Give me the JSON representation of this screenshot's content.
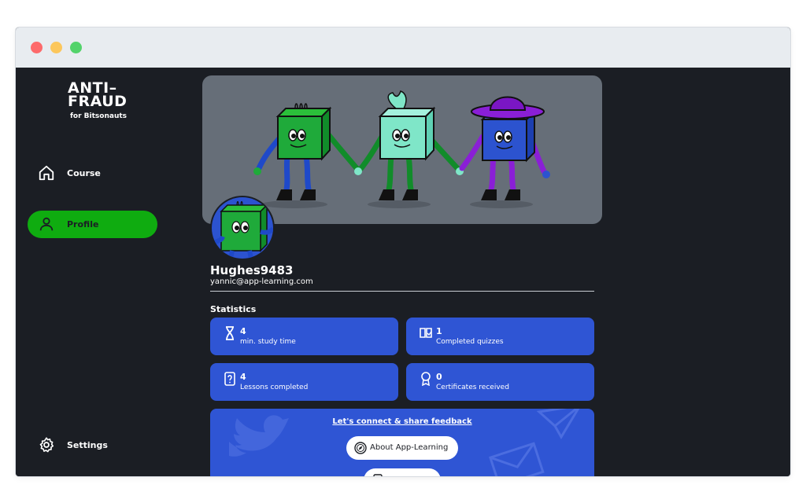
{
  "logo": {
    "line1": "ANTI–",
    "line2": "FRAUD",
    "subtitle": "for Bitsonauts"
  },
  "sidebar": {
    "items": [
      {
        "label": "Course",
        "icon": "home-icon"
      },
      {
        "label": "Profile",
        "icon": "user-icon",
        "active": true
      }
    ],
    "settings": {
      "label": "Settings",
      "icon": "gear-icon"
    }
  },
  "profile": {
    "username": "Hughes9483",
    "email": "yannic@app-learning.com"
  },
  "statistics": {
    "title": "Statistics",
    "items": [
      {
        "value": "4",
        "label": "min. study time",
        "icon": "hourglass-icon"
      },
      {
        "value": "1",
        "label": "Completed quizzes",
        "icon": "book-icon"
      },
      {
        "value": "4",
        "label": "Lessons completed",
        "icon": "question-doc-icon"
      },
      {
        "value": "0",
        "label": "Certificates received",
        "icon": "award-icon"
      }
    ]
  },
  "connect": {
    "link": "Let's connect & share feedback",
    "about_button": "About App-Learning"
  },
  "colors": {
    "accent_green": "#0fac10",
    "card_blue": "#2f55d4",
    "background": "#1b1e24",
    "banner": "#666e78"
  }
}
